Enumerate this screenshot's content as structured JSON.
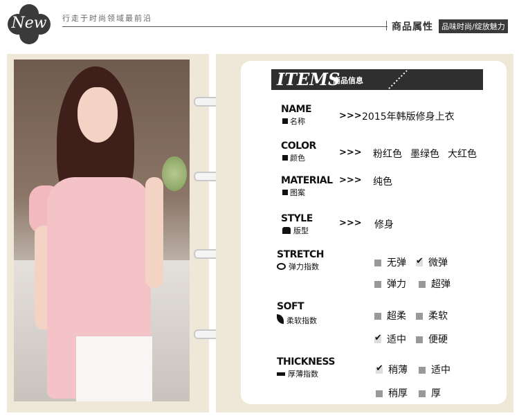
{
  "header": {
    "logo_text": "New",
    "tagline": "行走于时尚领域最前沿",
    "attr_title": "商品属性",
    "attr_badge": "品味时尚/绽放魅力"
  },
  "items": {
    "title": "ITEMS",
    "title_cn": "商品信息"
  },
  "fields": {
    "name": {
      "en": "NAME",
      "cn": "名称",
      "arrow": ">>>",
      "value": "2015年韩版修身上衣"
    },
    "color": {
      "en": "COLOR",
      "cn": "颜色",
      "arrow": ">>>",
      "values": [
        "粉红色",
        "墨绿色",
        "大红色"
      ]
    },
    "material": {
      "en": "MATERIAL",
      "cn": "图案",
      "arrow": ">>>",
      "value": "纯色"
    },
    "style": {
      "en": "STYLE",
      "cn": "版型",
      "arrow": ">>>",
      "value": "修身"
    }
  },
  "stretch": {
    "en": "STRETCH",
    "cn": "弹力指数",
    "options": [
      {
        "label": "无弹",
        "checked": false
      },
      {
        "label": "微弹",
        "checked": true
      },
      {
        "label": "弹力",
        "checked": false
      },
      {
        "label": "超弹",
        "checked": false
      }
    ]
  },
  "soft": {
    "en": "SOFT",
    "cn": "柔软指数",
    "options": [
      {
        "label": "超柔",
        "checked": false
      },
      {
        "label": "柔软",
        "checked": false
      },
      {
        "label": "适中",
        "checked": true
      },
      {
        "label": "便硬",
        "checked": false
      }
    ]
  },
  "thickness": {
    "en": "THICKNESS",
    "cn": "厚薄指数",
    "options": [
      {
        "label": "稍薄",
        "checked": true
      },
      {
        "label": "适中",
        "checked": false
      },
      {
        "label": "稍厚",
        "checked": false
      },
      {
        "label": "厚",
        "checked": false
      }
    ]
  },
  "colors": {
    "dark_bar": "#2f2f2f",
    "panel_bg": "#efe7d8",
    "shirt_pink": "#f4c3c8"
  }
}
